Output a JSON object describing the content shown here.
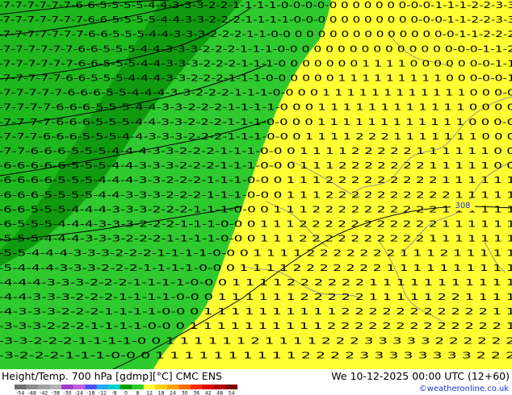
{
  "map": {
    "field_colors": {
      "green_dark": "#109a10",
      "green_mid": "#1eb81e",
      "green_light": "#2fca2f",
      "yellow": "#ffff33"
    },
    "contour_line_color": "#000000",
    "contour_label": "308"
  },
  "rows": [
    "-7-7-7-7-7-7-6-6-5-5-5-5-4-4-3-3-3-2-2-1-1-1-1-0-0-0-0-0 0 0 0 0 0 0-0-0-1-1-1-2-2-3-3",
    "-7-7-7-7-7-7-7-6-6-5-5-5-5-4-4-3-3-2-2-2-1-1-1-1-0-0-0 0 0 0 0 0 0 0 0-0-0-1-1-2-2-3-3",
    "-7-7-7-7-7-7-7-6-6-5-5-5-4-4-3-3-3-2-2-2-1-1-0-0 0 0 0 0 0 0 0 0 0 0 0 0 0-0-1-1-2-2-2",
    "-7-7-7-7-7-7-6-6-5-5-5-4-4-3-3-3-2-2-2-1-1-1-0-0 0 0 0 0 0 0 0 0 0 0 0 0 0-0-0-1-1-2",
    "-7-7-7-7-7-7-6-6-5-5-5-4-4-3-3-3-2-2-2-1-1-1-0 0 0 0 0 0 0 1 1 1 1 0 0 0 0 0 0-0-1-1",
    "-7-7-7-7-7-6-6-5-5-5-4-4-4-3-3-2-2-2-1-1-1-0-0 0 0 0 0 1 1 1 1 1 1 1 1 1 0 0 0-0-0-1",
    "-7-7-7-7-7-6-6-6-5-5-4-4-4-3-3-2-2-2-1-1-1-0-0 0 0 1 1 1 1 1 1 1 1 1 1 1 1 0 0 0-0",
    "-7-7-7-7-6-6-6-5-5-5-4-4-3-3-2-2-2-1-1-1-1-0 0 0 1 1 1 1 1 1 1 1 1 1 1 1 0 0 0 0",
    "-7-7-7-7-6-6-6-5-5-5-4-4-3-3-2-2-2-1-1-1-0-0 0 0 1 1 1 1 1 1 1 1 1 1 1 1 0 0 0-0",
    "-7-7-7-6-6-6-5-5-5-4-4-3-3-3-2-2-2-1-1-1-0-0 0 1 1 1 1 2 2 2 1 1 1 1 1 1 1 0 0 0",
    "-7-7-6-6-6-5-5-5-4-4-4-3-3-2-2-2-1-1-1-0-0 0 1 1 1 1 2 2 2 2 2 1 1 1 1 1 1 0 0",
    "-6-6-6-6-6-5-5-5-4-4-3-3-3-2-2-2-1-1-1-0-0 0 1 1 1 2 2 2 2 2 2 2 1 1 1 1 1 0 0",
    "-6-6-6-6-5-5-5-4-4-4-3-3-2-2-2-1-1-1-0-0 0 1 1 1 2 2 2 2 2 2 2 2 2 1 1 1 1 1 1",
    "-6-6-6-5-5-5-5-4-4-3-3-3-2-2-2-1-1-1-0-0 0 1 1 1 2 2 2 2 2 2 2 2 2 2 1 1 1 1 1",
    "-6-6-5-5-5-4-4-4-3-3-3-2-2-2-1-1-1-0-0 0 1 1 1 2 2 2 2 2 2 2 2 2 2 1 1 1 1 1 1",
    "-6-5-5-5-4-4-4-3-3-3-2-2-2-1-1-1-0-0 0 1 1 1 2 2 2 2 2 2 2 2 2 2 2 1 1 1 1 1 1",
    "-5-5-5-4-4-4-3-3-3-2-2-2-1-1-1-1-0-0 0 1 1 1 2 2 2 2 2 2 2 2 2 2 1 1 1 1 1 1 1",
    "-5-5-4-4-4-3-3-3-2-2-2-1-1-1-1-0-0 0 1 1 1 1 2 2 2 2 2 2 2 1 1 1 2 1 1 1 1 1",
    "-5-4-4-4-3-3-3-2-2-2-1-1-1-1-0-0 0 1 1 1 1 2 2 2 2 2 2 2 1 1 1 1 1 1 1 1 1 1",
    "-4-4-4-3-3-3-2-2-2-1-1-1-1-0-0 0 1 1 1 1 2 2 2 2 2 2 1 1 1 1 1 1 1 1 1 1 1",
    "-4-4-3-3-3-2-2-2-1-1-1-1-0-0 0 1 1 1 1 1 1 2 2 2 2 2 1 1 1 1 1 2 2 1 1 1 1",
    "-4-3-3-3-2-2-2-1-1-1-1-0-0 0 1 1 1 1 1 1 1 1 1 1 2 2 2 2 2 2 2 2 2 2 2 1 1",
    "-3-3-3-2-2-2-1-1-1-1-0-0 0 1 1 1 1 1 1 1 1 1 1 2 2 2 2 2 2 2 2 2 2 2 2 2 1",
    "-3-3-2-2-2-1-1-1-1-0 0 1 1 1 1 1 1 2 1 1 1 1 2 2 2 3 3 3 3 3 2 2 2 2 2 2",
    "-3-2-2-2-1-1-1-0-0 0 1 1 1 1 1 1 1 1 1 1 2 2 2 2 3 3 3 3 3 3 3 3 2 2 2"
  ],
  "footer": {
    "title": "Height/Temp. 700 hPa [gdmp][°C] CMC ENS",
    "valid_time": "We 10-12-2025 00:00 UTC (12+60)",
    "credit": "©weatheronline.co.uk",
    "colorbar_ticks": [
      "-54",
      "-48",
      "-42",
      "-38",
      "-30",
      "-24",
      "-18",
      "-12",
      "-8",
      "0",
      "8",
      "12",
      "18",
      "24",
      "30",
      "36",
      "42",
      "48",
      "54"
    ],
    "colorbar_colors": [
      "#6e6e6e",
      "#8c8c8c",
      "#a0a0a0",
      "#b4b4b4",
      "#9b3fc8",
      "#c060e0",
      "#5050f0",
      "#28a8f0",
      "#00d0d0",
      "#00a000",
      "#2fca2f",
      "#ffff33",
      "#ffd000",
      "#ffa000",
      "#ff6a00",
      "#ff2a00",
      "#e00000",
      "#b00000",
      "#800000"
    ]
  }
}
